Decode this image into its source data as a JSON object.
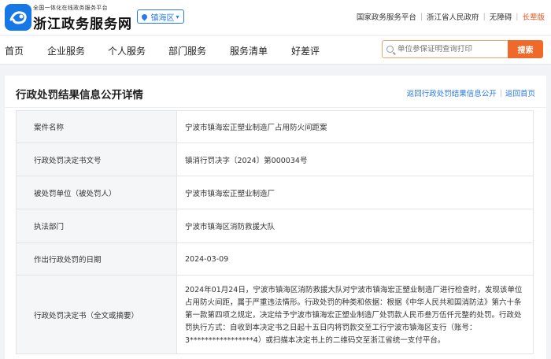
{
  "header": {
    "logo_small": "全国一体化在线政务服务平台",
    "logo_main": "浙江政务服务网",
    "region": "镇海区",
    "top_links": [
      {
        "label": "国家政务服务平台"
      },
      {
        "label": "浙江省人民政府"
      },
      {
        "label": "无障碍"
      },
      {
        "label": "长辈版",
        "active": true
      }
    ],
    "accent_color": "#ef6a2a",
    "brand_color": "#1677e6"
  },
  "nav": {
    "items": [
      "首页",
      "企业服务",
      "个人服务",
      "部门服务",
      "服务清单",
      "好差评"
    ],
    "search_placeholder": "单位参保证明查询打印",
    "search_button": "搜索"
  },
  "panel": {
    "title": "行政处罚结果信息公开详情",
    "back_list": "返回行政处罚结果信息公开",
    "back_home": "返回首页"
  },
  "table": {
    "rows": [
      {
        "label": "案件名称",
        "value": "宁波市镇海宏正塑业制造厂占用防火间距案"
      },
      {
        "label": "行政处罚决定书文号",
        "value": "镇消行罚决字〔2024〕第000034号"
      },
      {
        "label": "被处罚单位（被处罚人）",
        "value": "宁波市镇海宏正塑业制造厂"
      },
      {
        "label": "执法部门",
        "value": "宁波市镇海区消防救援大队"
      },
      {
        "label": "作出行政处罚的日期",
        "value": "2024-03-09"
      },
      {
        "label": "行政处罚决定书（全文或摘要）",
        "value": "2024年01月24日，宁波市镇海区消防救援大队对宁波市镇海宏正塑业制造厂进行检查时，发现该单位占用防火间距，属于严重违法情形。行政处罚的种类和依据：根据《中华人民共和国消防法》第六十条第一款第四项之规定，决定给予宁波市镇海宏正塑业制造厂处罚款人民币叁万伍仟元整的处罚。行政处罚执行方式：自收到本决定书之日起十五日内将罚款交至工行宁波市镇海区支行（账号：3*****************4）或扫描本决定书上的二维码交至浙江省统一支付平台。"
      }
    ]
  }
}
